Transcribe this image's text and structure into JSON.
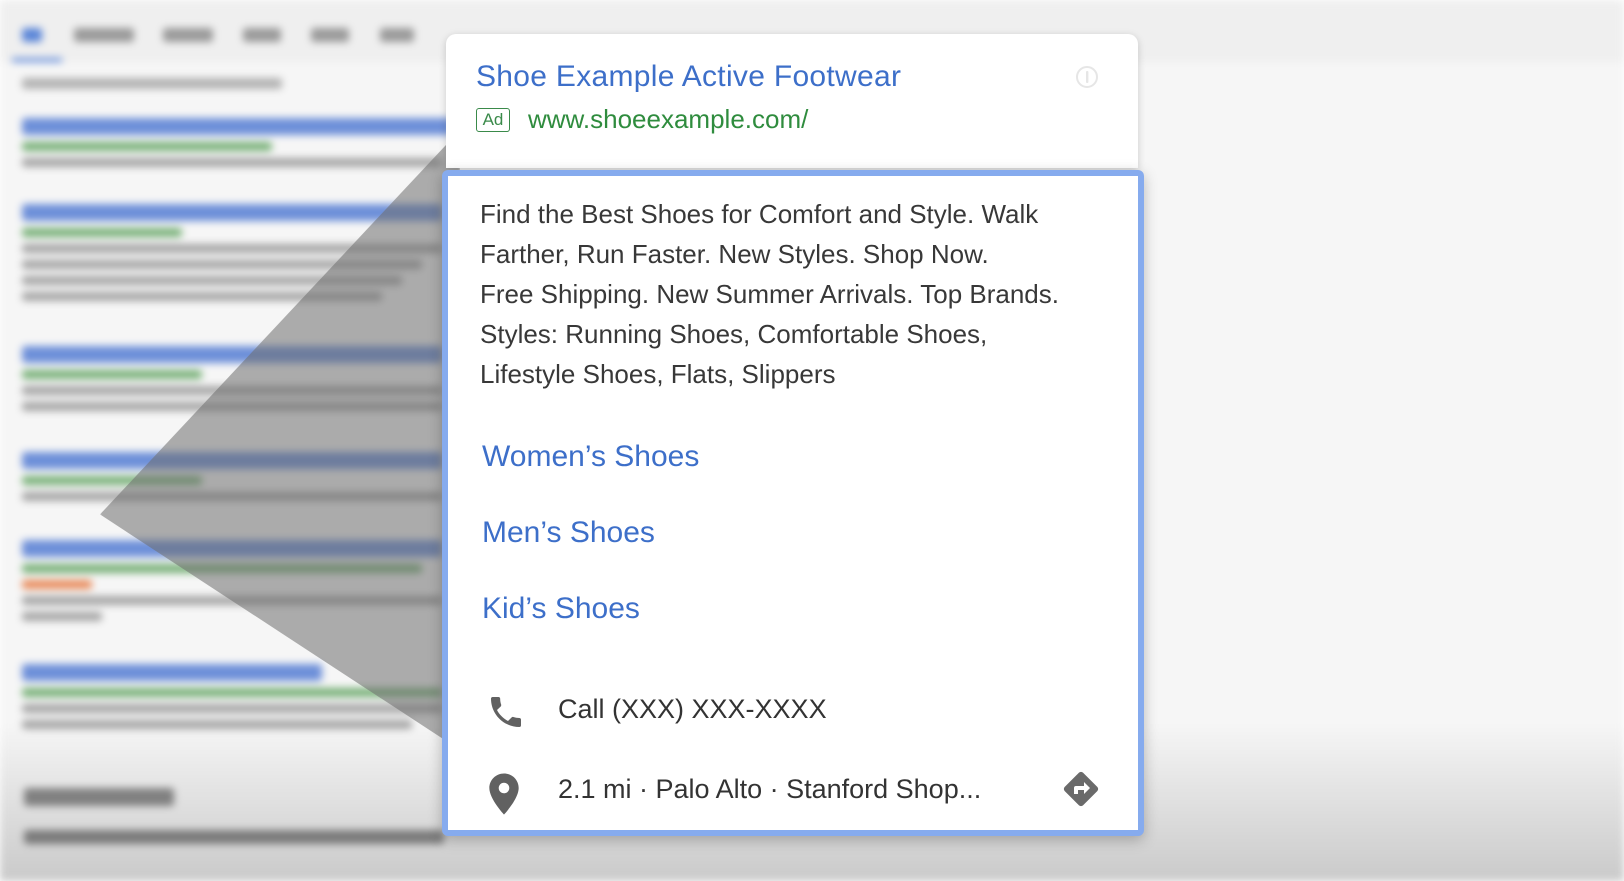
{
  "ad": {
    "title": "Shoe Example Active Footwear",
    "badge": "Ad",
    "display_url": "www.shoeexample.com/",
    "description_lines": [
      "Find the Best Shoes for Comfort and Style. Walk",
      "Farther, Run Faster. New Styles. Shop Now.",
      "Free Shipping. New Summer Arrivals. Top Brands.",
      "Styles: Running Shoes, Comfortable Shoes,",
      "Lifestyle Shoes, Flats, Slippers"
    ],
    "sitelinks": [
      {
        "label": "Women’s Shoes"
      },
      {
        "label": "Men’s Shoes"
      },
      {
        "label": "Kid’s Shoes"
      }
    ],
    "call_extension": {
      "text": "Call (XXX) XXX-XXXX",
      "icon": "phone-icon"
    },
    "location_extension": {
      "text": "2.1 mi · Palo Alto · Stanford Shop...",
      "icon": "map-pin-icon",
      "action_icon": "directions-icon"
    }
  },
  "colors": {
    "link_blue": "#3d6fc9",
    "url_green": "#2f8c3e",
    "highlight_border": "#86abee",
    "body_text": "#383838"
  }
}
